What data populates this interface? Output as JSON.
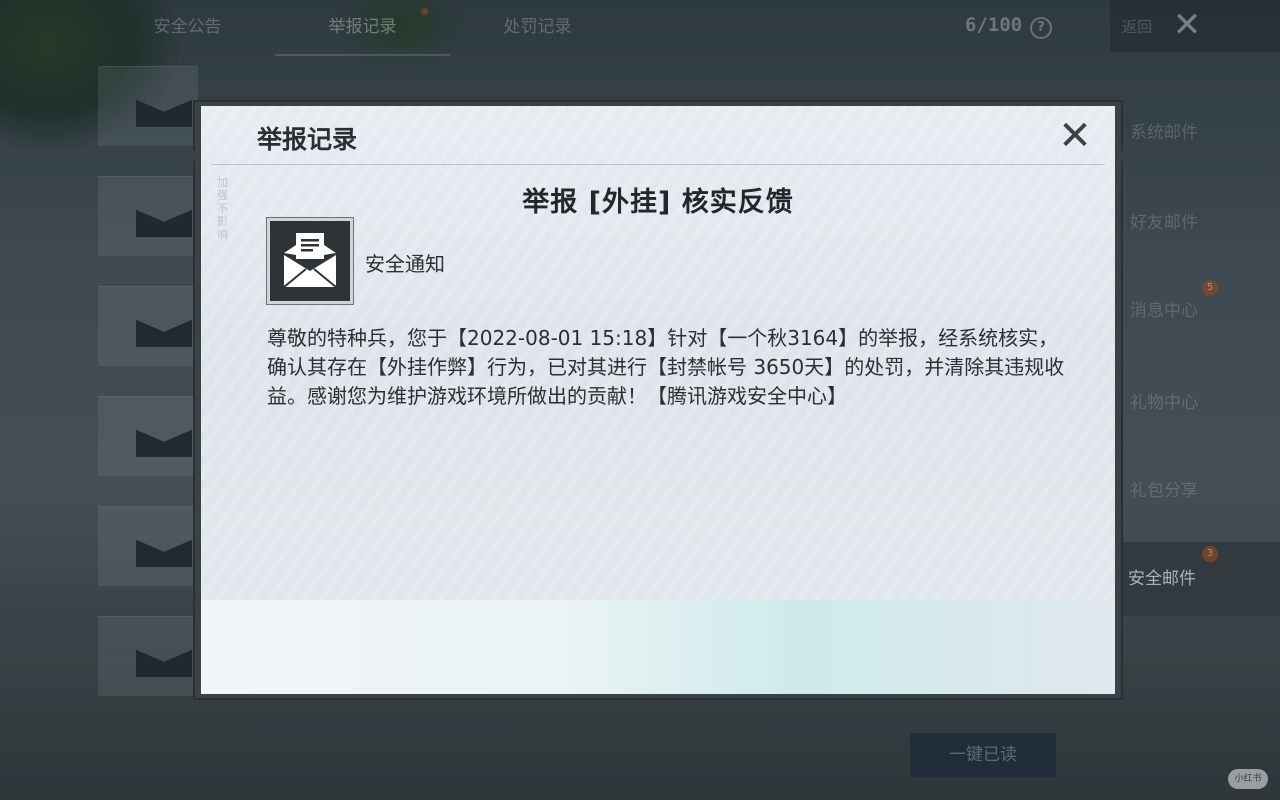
{
  "top_tabs": [
    "安全公告",
    "举报记录",
    "处罚记录"
  ],
  "mail_count": "6/100",
  "help_symbol": "?",
  "top_right_label": "返回",
  "close_symbol": "✕",
  "right_menu": {
    "items": [
      {
        "label": "系统邮件",
        "badge": ""
      },
      {
        "label": "好友邮件",
        "badge": ""
      },
      {
        "label": "消息中心",
        "badge": "5"
      },
      {
        "label": "礼物中心",
        "badge": ""
      },
      {
        "label": "礼包分享",
        "badge": ""
      },
      {
        "label": "安全邮件",
        "badge": "3"
      }
    ],
    "active_index": 5
  },
  "read_all_label": "一键已读",
  "watermark": "小红书",
  "modal": {
    "title": "举报记录",
    "close_symbol": "✕",
    "side_text": "加强不影响",
    "notice_title": "举报 [外挂] 核实反馈",
    "notice_label": "安全通知",
    "body": "尊敬的特种兵，您于【2022-08-01 15:18】针对【一个秋3164】的举报，经系统核实，确认其存在【外挂作弊】行为，已对其进行【封禁帐号 3650天】的处罚，并清除其违规收益。感谢您为维护游戏环境所做出的贡献！【腾讯游戏安全中心】"
  },
  "icons": {
    "notice": "open-envelope-icon",
    "help": "help-circle-icon",
    "close": "close-icon",
    "mail": "envelope-icon"
  }
}
